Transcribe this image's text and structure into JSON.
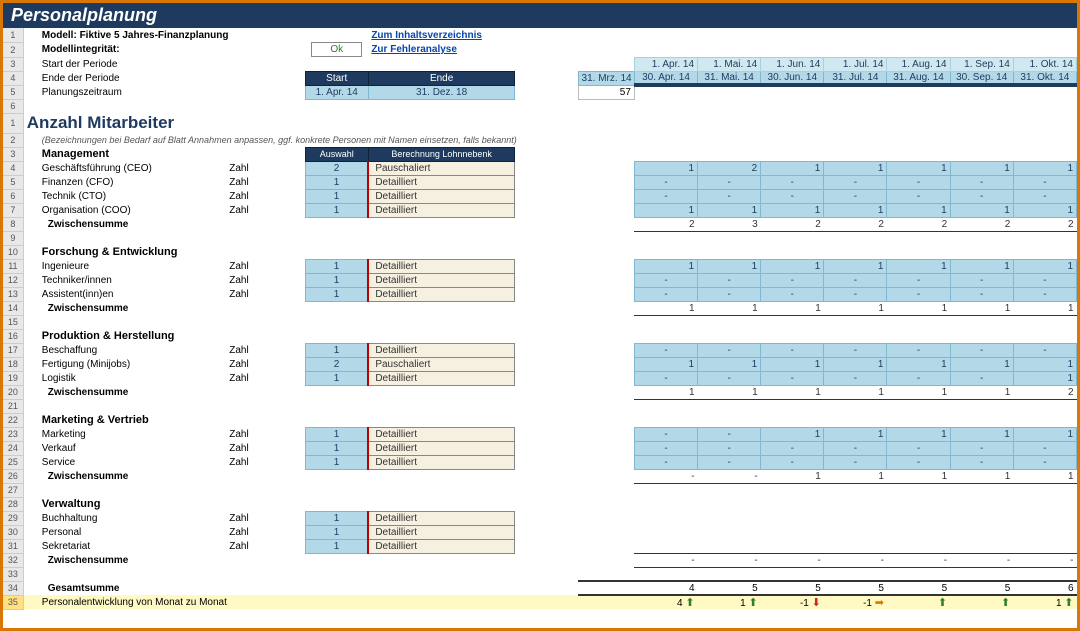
{
  "title": "Personalplanung",
  "header": {
    "modelLabel": "Modell:",
    "modelName": "Fiktive 5 Jahres-Finanzplanung",
    "integrityLabel": "Modellintegrität:",
    "integrityStatus": "Ok",
    "startLabel": "Start der Periode",
    "endLabel": "Ende der Periode",
    "periodLabel": "Planungszeitraum",
    "startHdr": "Start",
    "endHdr": "Ende",
    "startDate": "1. Apr. 14",
    "endDate": "31. Dez. 18",
    "endPriorDate": "31. Mrz. 14",
    "periodCount": "57",
    "linkToc": "Zum Inhaltsverzeichnis",
    "linkErr": "Zur Fehleranalyse"
  },
  "months": {
    "starts": [
      "1. Apr. 14",
      "1. Mai. 14",
      "1. Jun. 14",
      "1. Jul. 14",
      "1. Aug. 14",
      "1. Sep. 14",
      "1. Okt. 14"
    ],
    "ends": [
      "30. Apr. 14",
      "31. Mai. 14",
      "30. Jun. 14",
      "31. Jul. 14",
      "31. Aug. 14",
      "30. Sep. 14",
      "31. Okt. 14"
    ]
  },
  "main": {
    "heading": "Anzahl Mitarbeiter",
    "note": "(Bezeichnungen bei Bedarf auf Blatt Annahmen anpassen, ggf. konkrete Personen mit Namen einsetzen, falls bekannt)",
    "colSel": "Auswahl",
    "colCalc": "Berechnung Lohnnebenk",
    "zsLabel": "Zwischensumme",
    "typeZahl": "Zahl",
    "calcPausch": "Pauschaliert",
    "calcDetail": "Detailliert",
    "groups": [
      {
        "name": "Management",
        "rows": [
          {
            "label": "Geschäftsführung (CEO)",
            "sel": "2",
            "calc": "Pauschaliert",
            "vals": [
              "1",
              "2",
              "1",
              "1",
              "1",
              "1",
              "1"
            ]
          },
          {
            "label": "Finanzen (CFO)",
            "sel": "1",
            "calc": "Detailliert",
            "vals": [
              "-",
              "-",
              "-",
              "-",
              "-",
              "-",
              "-"
            ]
          },
          {
            "label": "Technik (CTO)",
            "sel": "1",
            "calc": "Detailliert",
            "vals": [
              "-",
              "-",
              "-",
              "-",
              "-",
              "-",
              "-"
            ]
          },
          {
            "label": "Organisation (COO)",
            "sel": "1",
            "calc": "Detailliert",
            "vals": [
              "1",
              "1",
              "1",
              "1",
              "1",
              "1",
              "1"
            ]
          }
        ],
        "subtotal": [
          "2",
          "3",
          "2",
          "2",
          "2",
          "2",
          "2"
        ]
      },
      {
        "name": "Forschung & Entwicklung",
        "rows": [
          {
            "label": "Ingenieure",
            "sel": "1",
            "calc": "Detailliert",
            "vals": [
              "1",
              "1",
              "1",
              "1",
              "1",
              "1",
              "1"
            ]
          },
          {
            "label": "Techniker/innen",
            "sel": "1",
            "calc": "Detailliert",
            "vals": [
              "-",
              "-",
              "-",
              "-",
              "-",
              "-",
              "-"
            ]
          },
          {
            "label": "Assistent(inn)en",
            "sel": "1",
            "calc": "Detailliert",
            "vals": [
              "-",
              "-",
              "-",
              "-",
              "-",
              "-",
              "-"
            ]
          }
        ],
        "subtotal": [
          "1",
          "1",
          "1",
          "1",
          "1",
          "1",
          "1"
        ]
      },
      {
        "name": "Produktion & Herstellung",
        "rows": [
          {
            "label": "Beschaffung",
            "sel": "1",
            "calc": "Detailliert",
            "vals": [
              "-",
              "-",
              "-",
              "-",
              "-",
              "-",
              "-"
            ]
          },
          {
            "label": "Fertigung (Minijobs)",
            "sel": "2",
            "calc": "Pauschaliert",
            "vals": [
              "1",
              "1",
              "1",
              "1",
              "1",
              "1",
              "1"
            ]
          },
          {
            "label": "Logistik",
            "sel": "1",
            "calc": "Detailliert",
            "vals": [
              "-",
              "-",
              "-",
              "-",
              "-",
              "-",
              "1"
            ]
          }
        ],
        "subtotal": [
          "1",
          "1",
          "1",
          "1",
          "1",
          "1",
          "2"
        ]
      },
      {
        "name": "Marketing & Vertrieb",
        "rows": [
          {
            "label": "Marketing",
            "sel": "1",
            "calc": "Detailliert",
            "vals": [
              "-",
              "-",
              "1",
              "1",
              "1",
              "1",
              "1"
            ]
          },
          {
            "label": "Verkauf",
            "sel": "1",
            "calc": "Detailliert",
            "vals": [
              "-",
              "-",
              "-",
              "-",
              "-",
              "-",
              "-"
            ]
          },
          {
            "label": "Service",
            "sel": "1",
            "calc": "Detailliert",
            "vals": [
              "-",
              "-",
              "-",
              "-",
              "-",
              "-",
              "-"
            ]
          }
        ],
        "subtotal": [
          "-",
          "-",
          "1",
          "1",
          "1",
          "1",
          "1"
        ]
      },
      {
        "name": "Verwaltung",
        "rows": [
          {
            "label": "Buchhaltung",
            "sel": "1",
            "calc": "Detailliert",
            "vals": []
          },
          {
            "label": "Personal",
            "sel": "1",
            "calc": "Detailliert",
            "vals": []
          },
          {
            "label": "Sekretariat",
            "sel": "1",
            "calc": "Detailliert",
            "vals": []
          }
        ],
        "subtotal": [
          "-",
          "-",
          "-",
          "-",
          "-",
          "-",
          "-"
        ]
      }
    ],
    "gesamtLabel": "Gesamtsumme",
    "gesamtVals": [
      "4",
      "5",
      "5",
      "5",
      "5",
      "5",
      "6"
    ],
    "devLabel": "Personalentwicklung von Monat zu Monat",
    "devVals": [
      "4",
      "1",
      "-1",
      "-1",
      "",
      "",
      "1"
    ]
  }
}
